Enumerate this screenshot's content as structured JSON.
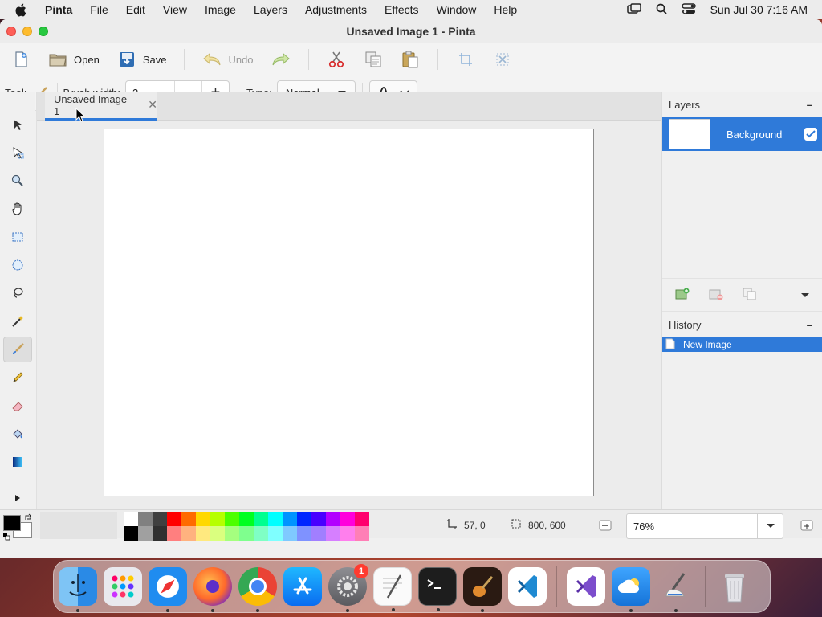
{
  "menubar": {
    "app_name": "Pinta",
    "items": [
      "File",
      "Edit",
      "View",
      "Image",
      "Layers",
      "Adjustments",
      "Effects",
      "Window",
      "Help"
    ],
    "clock": "Sun Jul 30  7:16 AM"
  },
  "window": {
    "title": "Unsaved Image 1 - Pinta"
  },
  "toolbar": {
    "open_label": "Open",
    "save_label": "Save",
    "undo_label": "Undo"
  },
  "tool_options": {
    "tool_label": "Tool:",
    "brush_width_label": "Brush width:",
    "brush_width_value": "2",
    "type_label": "Type:",
    "type_value": "Normal"
  },
  "tabs": [
    {
      "label": "Unsaved Image 1"
    }
  ],
  "layers_panel": {
    "title": "Layers",
    "layers": [
      {
        "name": "Background",
        "visible": true
      }
    ]
  },
  "history_panel": {
    "title": "History",
    "items": [
      "New Image"
    ]
  },
  "status": {
    "cursor_position": "57, 0",
    "image_size": "800, 600",
    "zoom": "76%"
  },
  "palette": {
    "primary": "#000000",
    "secondary": "#ffffff",
    "row1": [
      "#ffffff",
      "#808080",
      "#404040",
      "#ff0000",
      "#ff6a00",
      "#ffd800",
      "#b6ff00",
      "#4cff00",
      "#00ff21",
      "#00ff90",
      "#00ffff",
      "#0094ff",
      "#0026ff",
      "#4800ff",
      "#b200ff",
      "#ff00dc",
      "#ff006e"
    ],
    "row2": [
      "#000000",
      "#a0a0a0",
      "#303030",
      "#ff7f7f",
      "#ffb27f",
      "#ffe97f",
      "#daff7f",
      "#a5ff7f",
      "#7fff8e",
      "#7fffc5",
      "#7fffff",
      "#7fc9ff",
      "#7f92ff",
      "#a17fff",
      "#d67fff",
      "#ff7fed",
      "#ff7fb6"
    ]
  },
  "dock": {
    "apps": [
      "Finder",
      "Launchpad",
      "Safari",
      "Firefox",
      "Chrome",
      "App Store",
      "System Settings",
      "TextEdit",
      "Terminal",
      "GarageBand",
      "VS Code",
      "Visual Studio",
      "Weather",
      "Pinta",
      "Trash"
    ],
    "settings_badge": "1"
  },
  "colors": {
    "accent": "#2f7ad9"
  }
}
